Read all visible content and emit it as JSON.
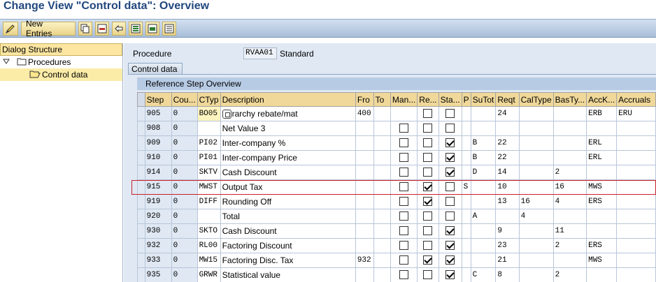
{
  "window": {
    "title": "Change View \"Control data\": Overview"
  },
  "toolbar": {
    "new_entries_label": "New Entries",
    "icons": [
      "display-change-icon",
      "copy-icon",
      "delete-icon",
      "undo-icon",
      "select-all-icon",
      "select-block-icon",
      "deselect-all-icon"
    ]
  },
  "dialog_structure": {
    "header": "Dialog Structure",
    "items": [
      {
        "label": "Procedures",
        "expanded": true,
        "level": 0
      },
      {
        "label": "Control data",
        "selected": true,
        "level": 1
      }
    ]
  },
  "procedure": {
    "label": "Procedure",
    "value": "RVAA01",
    "description": "Standard"
  },
  "tab": {
    "label": "Control data"
  },
  "table": {
    "title": "Reference Step Overview",
    "columns": [
      "Step",
      "Cou...",
      "CTyp",
      "Description",
      "Fro",
      "To",
      "Man...",
      "Re...",
      "Sta...",
      "P",
      "SuTot",
      "Reqt",
      "CalType",
      "BasTy...",
      "AccK...",
      "Accruals"
    ],
    "rows": [
      {
        "step": "905",
        "cou": "0",
        "ctyp": "BO05",
        "desc": "rarchy rebate/mat",
        "fro": "400",
        "to": "",
        "man": "",
        "re": false,
        "sta": false,
        "p": "",
        "sutot": "",
        "reqt": "24",
        "caltype": "",
        "basty": "",
        "acck": "ERB",
        "accruals": "ERU",
        "focused": true,
        "man_box": false
      },
      {
        "step": "908",
        "cou": "0",
        "ctyp": "",
        "desc": "Net Value 3",
        "fro": "",
        "to": "",
        "man": false,
        "re": false,
        "sta": false,
        "p": "",
        "sutot": "",
        "reqt": "",
        "caltype": "",
        "basty": "",
        "acck": "",
        "accruals": "",
        "man_box": true
      },
      {
        "step": "909",
        "cou": "0",
        "ctyp": "PI02",
        "desc": "Inter-company %",
        "fro": "",
        "to": "",
        "man": false,
        "re": false,
        "sta": true,
        "p": "",
        "sutot": "B",
        "reqt": "22",
        "caltype": "",
        "basty": "",
        "acck": "ERL",
        "accruals": "",
        "man_box": true
      },
      {
        "step": "910",
        "cou": "0",
        "ctyp": "PI01",
        "desc": "Inter-company Price",
        "fro": "",
        "to": "",
        "man": false,
        "re": false,
        "sta": true,
        "p": "",
        "sutot": "B",
        "reqt": "22",
        "caltype": "",
        "basty": "",
        "acck": "ERL",
        "accruals": "",
        "man_box": true
      },
      {
        "step": "914",
        "cou": "0",
        "ctyp": "SKTV",
        "desc": "Cash Discount",
        "fro": "",
        "to": "",
        "man": false,
        "re": false,
        "sta": true,
        "p": "",
        "sutot": "D",
        "reqt": "14",
        "caltype": "",
        "basty": "2",
        "acck": "",
        "accruals": "",
        "man_box": true
      },
      {
        "step": "915",
        "cou": "0",
        "ctyp": "MWST",
        "desc": "Output Tax",
        "fro": "",
        "to": "",
        "man": false,
        "re": true,
        "sta": false,
        "p": "S",
        "sutot": "",
        "reqt": "10",
        "caltype": "",
        "basty": "16",
        "acck": "MWS",
        "accruals": "",
        "man_box": true,
        "highlight": true
      },
      {
        "step": "919",
        "cou": "0",
        "ctyp": "DIFF",
        "desc": "Rounding Off",
        "fro": "",
        "to": "",
        "man": false,
        "re": true,
        "sta": false,
        "p": "",
        "sutot": "",
        "reqt": "13",
        "caltype": "16",
        "basty": "4",
        "acck": "ERS",
        "accruals": "",
        "man_box": true
      },
      {
        "step": "920",
        "cou": "0",
        "ctyp": "",
        "desc": "Total",
        "fro": "",
        "to": "",
        "man": false,
        "re": false,
        "sta": false,
        "p": "",
        "sutot": "A",
        "reqt": "",
        "caltype": "4",
        "basty": "",
        "acck": "",
        "accruals": "",
        "man_box": true
      },
      {
        "step": "930",
        "cou": "0",
        "ctyp": "SKTO",
        "desc": "Cash Discount",
        "fro": "",
        "to": "",
        "man": false,
        "re": false,
        "sta": true,
        "p": "",
        "sutot": "",
        "reqt": "9",
        "caltype": "",
        "basty": "11",
        "acck": "",
        "accruals": "",
        "man_box": true
      },
      {
        "step": "932",
        "cou": "0",
        "ctyp": "RL00",
        "desc": "Factoring Discount",
        "fro": "",
        "to": "",
        "man": false,
        "re": false,
        "sta": true,
        "p": "",
        "sutot": "",
        "reqt": "23",
        "caltype": "",
        "basty": "2",
        "acck": "ERS",
        "accruals": "",
        "man_box": true
      },
      {
        "step": "933",
        "cou": "0",
        "ctyp": "MW15",
        "desc": "Factoring Disc. Tax",
        "fro": "932",
        "to": "",
        "man": false,
        "re": true,
        "sta": true,
        "p": "",
        "sutot": "",
        "reqt": "21",
        "caltype": "",
        "basty": "",
        "acck": "MWS",
        "accruals": "",
        "man_box": true
      },
      {
        "step": "935",
        "cou": "0",
        "ctyp": "GRWR",
        "desc": "Statistical value",
        "fro": "",
        "to": "",
        "man": false,
        "re": false,
        "sta": true,
        "p": "",
        "sutot": "C",
        "reqt": "8",
        "caltype": "",
        "basty": "2",
        "acck": "",
        "accruals": "",
        "man_box": true
      }
    ]
  },
  "colors": {
    "title": "#21477e",
    "header_cell": "#f0d89a",
    "highlight_border": "#c8202a",
    "pane_bg": "#dfe8f3"
  }
}
